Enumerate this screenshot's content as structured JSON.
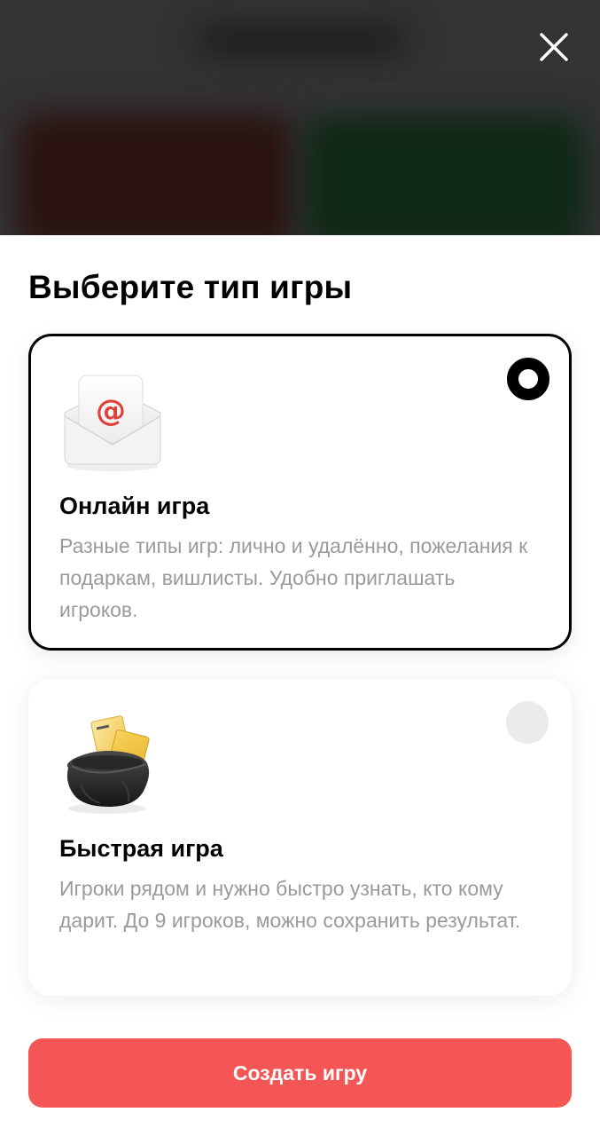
{
  "header": {
    "close_icon": "close-icon"
  },
  "sheet": {
    "title": "Выберите тип игры"
  },
  "options": [
    {
      "id": "online",
      "icon": "envelope-at-icon",
      "title": "Онлайн игра",
      "description": "Разные типы игр: лично и удалённо, пожелания к подаркам, вишлисты. Удобно приглашать игроков.",
      "selected": true
    },
    {
      "id": "quick",
      "icon": "hat-with-notes-icon",
      "title": "Быстрая игра",
      "description": "Игроки рядом и нужно быстро узнать, кто кому дарит. До 9 игроков, можно сохранить результат.",
      "selected": false
    }
  ],
  "footer": {
    "create_label": "Создать игру"
  },
  "colors": {
    "accent": "#f45555",
    "selected_border": "#000000",
    "description_text": "#9a9a9a",
    "radio_unselected": "#ebebee",
    "envelope_at_sign": "#e0403a",
    "note_yellow": "#f2c84b"
  }
}
